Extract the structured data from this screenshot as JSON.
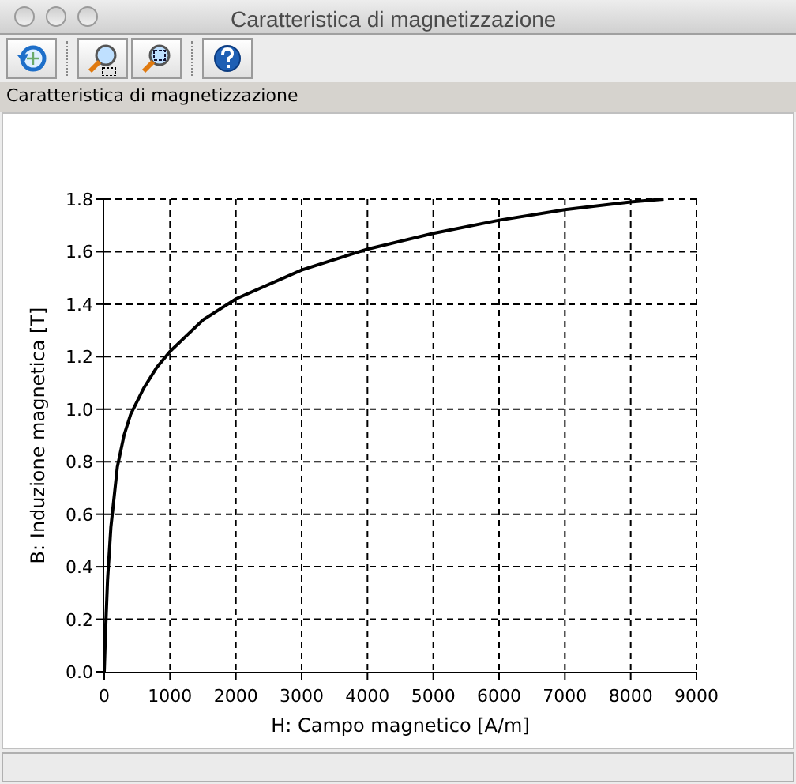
{
  "window": {
    "title": "Caratteristica di magnetizzazione"
  },
  "toolbar": [
    {
      "kind": "reset"
    },
    {
      "kind": "zoom"
    },
    {
      "kind": "zoom-area"
    },
    {
      "kind": "help"
    }
  ],
  "panel": {
    "title": "Caratteristica di magnetizzazione",
    "chart_data": {
      "type": "line",
      "xlabel": "H: Campo magnetico [A/m]",
      "ylabel": "B: Induzione magnetica [T]",
      "x": [
        0,
        20,
        50,
        100,
        200,
        300,
        400,
        600,
        800,
        1000,
        1500,
        2000,
        3000,
        4000,
        5000,
        6000,
        7000,
        8000,
        8500
      ],
      "series": [
        {
          "color": "#000000",
          "values": [
            0,
            0.15,
            0.35,
            0.55,
            0.78,
            0.9,
            0.98,
            1.08,
            1.16,
            1.22,
            1.34,
            1.42,
            1.53,
            1.61,
            1.67,
            1.72,
            1.76,
            1.79,
            1.8
          ]
        }
      ],
      "grid": true,
      "xlim": [
        0,
        9000
      ],
      "ylim": [
        0,
        1.8
      ],
      "xticks": [
        0,
        1000,
        2000,
        3000,
        4000,
        5000,
        6000,
        7000,
        8000,
        9000
      ],
      "yticks": [
        {
          "value": 0,
          "label": "0.0"
        },
        {
          "value": 0.2,
          "label": "0.2"
        },
        {
          "value": 0.4,
          "label": "0.4"
        },
        {
          "value": 0.6,
          "label": "0.6"
        },
        {
          "value": 0.8,
          "label": "0.8"
        },
        {
          "value": 1,
          "label": "1.0"
        },
        {
          "value": 1.2,
          "label": "1.2"
        },
        {
          "value": 1.4,
          "label": "1.4"
        },
        {
          "value": 1.6,
          "label": "1.6"
        },
        {
          "value": 1.8,
          "label": "1.8"
        }
      ]
    }
  }
}
